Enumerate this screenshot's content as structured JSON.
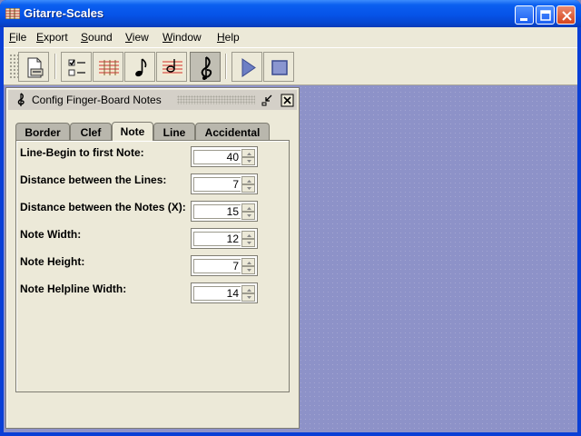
{
  "window": {
    "title": "Gitarre-Scales"
  },
  "menu": [
    {
      "label": "File",
      "mnemonic": "F",
      "rest": "ile"
    },
    {
      "label": "Export",
      "mnemonic": "E",
      "rest": "xport"
    },
    {
      "label": "Sound",
      "mnemonic": "S",
      "rest": "ound"
    },
    {
      "label": "View",
      "mnemonic": "V",
      "rest": "iew"
    },
    {
      "label": "Window",
      "mnemonic": "W",
      "rest": "indow"
    },
    {
      "label": "Help",
      "mnemonic": "H",
      "rest": "elp"
    }
  ],
  "toolbar": {
    "icons": [
      "print-preview-icon",
      "checklist-icon",
      "fretboard-icon",
      "note-icon",
      "fingerboard-notes-icon",
      "clef-icon",
      "play-icon",
      "stop-icon"
    ],
    "active": "clef-icon"
  },
  "internal_frame": {
    "title": "Config Finger-Board Notes",
    "tabs": [
      {
        "label": "Border"
      },
      {
        "label": "Clef"
      },
      {
        "label": "Note",
        "selected": true
      },
      {
        "label": "Line"
      },
      {
        "label": "Accidental"
      }
    ],
    "fields": [
      {
        "label": "Line-Begin to first Note:",
        "value": "40"
      },
      {
        "label": "Distance between the Lines:",
        "value": "7"
      },
      {
        "label": "Distance between the Notes (X):",
        "value": "15"
      },
      {
        "label": "Note Width:",
        "value": "12"
      },
      {
        "label": "Note Height:",
        "value": "7"
      },
      {
        "label": "Note Helpline Width:",
        "value": "14"
      }
    ]
  },
  "colors": {
    "titlebar": "#0653e8",
    "desktop": "#8d92c8",
    "panel": "#ece9d8"
  }
}
